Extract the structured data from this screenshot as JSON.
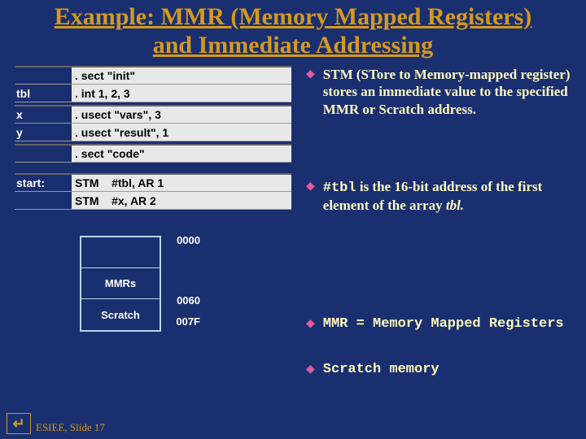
{
  "title_line1": "Example: MMR (Memory Mapped Registers)",
  "title_line2": "and Immediate Addressing",
  "code": {
    "r1": {
      "label": "",
      "text": ". sect \"init\""
    },
    "r2": {
      "label": "tbl",
      "text": ". int 1, 2, 3"
    },
    "r3": {
      "label": "x",
      "text": ". usect \"vars\", 3"
    },
    "r4": {
      "label": "y",
      "text": ". usect \"result\", 1"
    },
    "r5": {
      "label": "",
      "text": ". sect \"code\""
    },
    "r6": {
      "label": "start:",
      "text": "STM    #tbl, AR 1"
    },
    "r7": {
      "label": "",
      "text": "STM    #x, AR 2"
    }
  },
  "bullets": {
    "b1": "STM (STore to Memory-mapped register) stores an immediate value to the specified MMR or Scratch address.",
    "b2_mono": "#tbl",
    "b2_rest": " is the 16-bit address of the first element of the array ",
    "b2_ital": "tbl.",
    "b3": "MMR = Memory Mapped Registers",
    "b4": "Scratch memory"
  },
  "mem": {
    "a0": "0000",
    "c0": "MMRs",
    "a1": "0060",
    "c1": "Scratch",
    "a2": "007F"
  },
  "footer": {
    "icon": "↵",
    "text": "ESIEE, Slide 17"
  }
}
